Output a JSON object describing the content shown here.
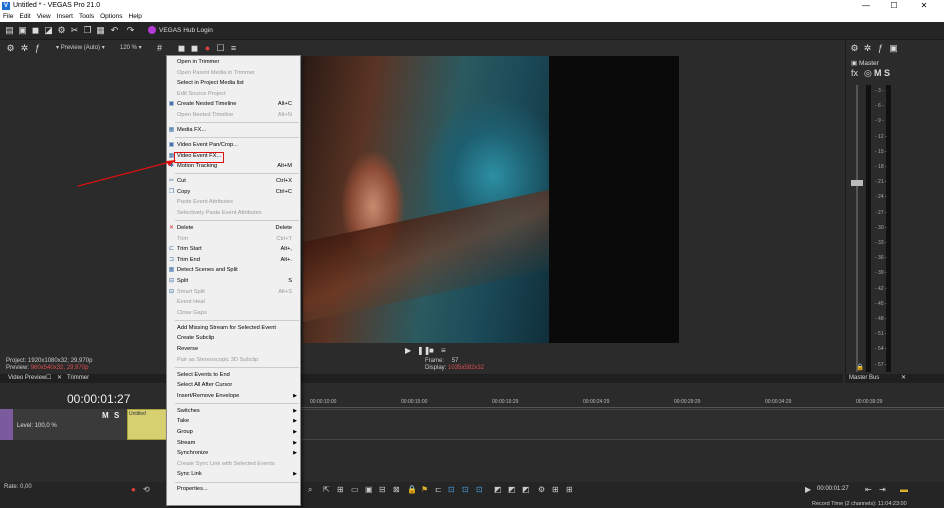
{
  "window": {
    "title": "Untitled * - VEGAS Pro 21.0",
    "app_icon": "V",
    "minimize": "—",
    "maximize": "☐",
    "close": "✕"
  },
  "menubar": [
    "File",
    "Edit",
    "View",
    "Insert",
    "Tools",
    "Options",
    "Help"
  ],
  "hub_label": "VEGAS Hub Login",
  "preview_toolbar": {
    "mode": "Preview (Auto)",
    "zoom": "120 %"
  },
  "info": {
    "project_label": "Project:",
    "project_value": "1920x1080x32; 29,970p",
    "preview_label": "Preview:",
    "preview_value": "960x540x32; 29,970p",
    "frame_label": "Frame:",
    "frame_value": "57",
    "display_label": "Display:",
    "display_value": "1035x582x32"
  },
  "tabs": [
    "Video Preview",
    "Trimmer"
  ],
  "master": {
    "label": "Master",
    "fx": "fx",
    "m": "M",
    "s": "S",
    "bus_tab": "Master Bus",
    "ticks": [
      "3",
      "6",
      "9",
      "12",
      "15",
      "18",
      "21",
      "24",
      "27",
      "30",
      "33",
      "36",
      "39",
      "42",
      "45",
      "48",
      "51",
      "54",
      "57"
    ]
  },
  "timeline": {
    "timecode": "00:00:01:27",
    "level": "Level: 100,0 %",
    "m": "M",
    "s": "S",
    "clip_name": "Untitled",
    "ruler": [
      "00:00:10:00",
      "00:00:15:00",
      "00:00:19:29",
      "00:00:24:29",
      "00:00:29:29",
      "00:00:34:29",
      "00:00:39:29"
    ],
    "rate": "Rate: 0,00",
    "record_timecode": "00:00:01:27",
    "record_time": "Record Time (2 channels): 11:04:23:00"
  },
  "context_menu": [
    {
      "label": "Open in Trimmer",
      "shortcut": "",
      "disabled": false
    },
    {
      "label": "Open Parent Media in Trimmer",
      "shortcut": "",
      "disabled": true
    },
    {
      "label": "Select in Project Media list",
      "shortcut": "",
      "disabled": false
    },
    {
      "label": "Edit Source Project",
      "shortcut": "",
      "disabled": true
    },
    {
      "label": "Create Nested Timeline",
      "shortcut": "Alt+C",
      "disabled": false
    },
    {
      "label": "Open Nested Timeline",
      "shortcut": "Alt+N",
      "disabled": true
    },
    {
      "sep": true
    },
    {
      "label": "Media FX...",
      "shortcut": "",
      "disabled": false
    },
    {
      "sep": true
    },
    {
      "label": "Video Event Pan/Crop...",
      "shortcut": "",
      "disabled": false
    },
    {
      "label": "Video Event FX...",
      "shortcut": "",
      "disabled": false
    },
    {
      "label": "Motion Tracking",
      "shortcut": "Alt+M",
      "disabled": false
    },
    {
      "sep": true
    },
    {
      "label": "Cut",
      "shortcut": "Ctrl+X",
      "disabled": false
    },
    {
      "label": "Copy",
      "shortcut": "Ctrl+C",
      "disabled": false
    },
    {
      "label": "Paste Event Attributes",
      "shortcut": "",
      "disabled": true
    },
    {
      "label": "Selectively Paste Event Attributes",
      "shortcut": "",
      "disabled": true
    },
    {
      "sep": true
    },
    {
      "label": "Delete",
      "shortcut": "Delete",
      "disabled": false
    },
    {
      "label": "Trim",
      "shortcut": "Ctrl+T",
      "disabled": true
    },
    {
      "label": "Trim Start",
      "shortcut": "Alt+,",
      "disabled": false
    },
    {
      "label": "Trim End",
      "shortcut": "Alt+.",
      "disabled": false
    },
    {
      "label": "Detect Scenes and Split",
      "shortcut": "",
      "disabled": false
    },
    {
      "label": "Split",
      "shortcut": "S",
      "disabled": false
    },
    {
      "label": "Smart Split",
      "shortcut": "Alt+S",
      "disabled": true
    },
    {
      "label": "Event Heal",
      "shortcut": "",
      "disabled": true
    },
    {
      "label": "Close Gaps",
      "shortcut": "",
      "disabled": true
    },
    {
      "sep": true
    },
    {
      "label": "Add Missing Stream for Selected Event",
      "shortcut": "",
      "disabled": false
    },
    {
      "label": "Create Subclip",
      "shortcut": "",
      "disabled": false
    },
    {
      "label": "Reverse",
      "shortcut": "",
      "disabled": false
    },
    {
      "label": "Pair as Stereoscopic 3D Subclip",
      "shortcut": "",
      "disabled": true
    },
    {
      "sep": true
    },
    {
      "label": "Select Events to End",
      "shortcut": "",
      "disabled": false
    },
    {
      "label": "Select All After Cursor",
      "shortcut": "",
      "disabled": false
    },
    {
      "label": "Insert/Remove Envelope",
      "shortcut": "",
      "disabled": false,
      "sub": true
    },
    {
      "sep": true
    },
    {
      "label": "Switches",
      "shortcut": "",
      "disabled": false,
      "sub": true
    },
    {
      "label": "Take",
      "shortcut": "",
      "disabled": false,
      "sub": true
    },
    {
      "label": "Group",
      "shortcut": "",
      "disabled": false,
      "sub": true
    },
    {
      "label": "Stream",
      "shortcut": "",
      "disabled": false,
      "sub": true
    },
    {
      "label": "Synchronize",
      "shortcut": "",
      "disabled": false,
      "sub": true
    },
    {
      "label": "Create Sync Link with Selected Events",
      "shortcut": "",
      "disabled": true
    },
    {
      "label": "Sync Link",
      "shortcut": "",
      "disabled": false,
      "sub": true
    },
    {
      "sep": true
    },
    {
      "label": "Properties...",
      "shortcut": "",
      "disabled": false
    }
  ],
  "colors": {
    "highlight": "#e01010",
    "accent": "#1e6fd0",
    "clip": "#d7d070",
    "track": "#7b5a9e"
  }
}
